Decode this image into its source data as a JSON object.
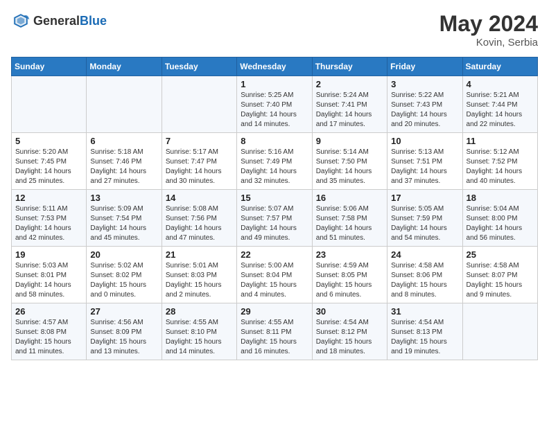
{
  "header": {
    "logo_general": "General",
    "logo_blue": "Blue",
    "month_year": "May 2024",
    "location": "Kovin, Serbia"
  },
  "days_of_week": [
    "Sunday",
    "Monday",
    "Tuesday",
    "Wednesday",
    "Thursday",
    "Friday",
    "Saturday"
  ],
  "weeks": [
    [
      {
        "day": "",
        "info": ""
      },
      {
        "day": "",
        "info": ""
      },
      {
        "day": "",
        "info": ""
      },
      {
        "day": "1",
        "info": "Sunrise: 5:25 AM\nSunset: 7:40 PM\nDaylight: 14 hours\nand 14 minutes."
      },
      {
        "day": "2",
        "info": "Sunrise: 5:24 AM\nSunset: 7:41 PM\nDaylight: 14 hours\nand 17 minutes."
      },
      {
        "day": "3",
        "info": "Sunrise: 5:22 AM\nSunset: 7:43 PM\nDaylight: 14 hours\nand 20 minutes."
      },
      {
        "day": "4",
        "info": "Sunrise: 5:21 AM\nSunset: 7:44 PM\nDaylight: 14 hours\nand 22 minutes."
      }
    ],
    [
      {
        "day": "5",
        "info": "Sunrise: 5:20 AM\nSunset: 7:45 PM\nDaylight: 14 hours\nand 25 minutes."
      },
      {
        "day": "6",
        "info": "Sunrise: 5:18 AM\nSunset: 7:46 PM\nDaylight: 14 hours\nand 27 minutes."
      },
      {
        "day": "7",
        "info": "Sunrise: 5:17 AM\nSunset: 7:47 PM\nDaylight: 14 hours\nand 30 minutes."
      },
      {
        "day": "8",
        "info": "Sunrise: 5:16 AM\nSunset: 7:49 PM\nDaylight: 14 hours\nand 32 minutes."
      },
      {
        "day": "9",
        "info": "Sunrise: 5:14 AM\nSunset: 7:50 PM\nDaylight: 14 hours\nand 35 minutes."
      },
      {
        "day": "10",
        "info": "Sunrise: 5:13 AM\nSunset: 7:51 PM\nDaylight: 14 hours\nand 37 minutes."
      },
      {
        "day": "11",
        "info": "Sunrise: 5:12 AM\nSunset: 7:52 PM\nDaylight: 14 hours\nand 40 minutes."
      }
    ],
    [
      {
        "day": "12",
        "info": "Sunrise: 5:11 AM\nSunset: 7:53 PM\nDaylight: 14 hours\nand 42 minutes."
      },
      {
        "day": "13",
        "info": "Sunrise: 5:09 AM\nSunset: 7:54 PM\nDaylight: 14 hours\nand 45 minutes."
      },
      {
        "day": "14",
        "info": "Sunrise: 5:08 AM\nSunset: 7:56 PM\nDaylight: 14 hours\nand 47 minutes."
      },
      {
        "day": "15",
        "info": "Sunrise: 5:07 AM\nSunset: 7:57 PM\nDaylight: 14 hours\nand 49 minutes."
      },
      {
        "day": "16",
        "info": "Sunrise: 5:06 AM\nSunset: 7:58 PM\nDaylight: 14 hours\nand 51 minutes."
      },
      {
        "day": "17",
        "info": "Sunrise: 5:05 AM\nSunset: 7:59 PM\nDaylight: 14 hours\nand 54 minutes."
      },
      {
        "day": "18",
        "info": "Sunrise: 5:04 AM\nSunset: 8:00 PM\nDaylight: 14 hours\nand 56 minutes."
      }
    ],
    [
      {
        "day": "19",
        "info": "Sunrise: 5:03 AM\nSunset: 8:01 PM\nDaylight: 14 hours\nand 58 minutes."
      },
      {
        "day": "20",
        "info": "Sunrise: 5:02 AM\nSunset: 8:02 PM\nDaylight: 15 hours\nand 0 minutes."
      },
      {
        "day": "21",
        "info": "Sunrise: 5:01 AM\nSunset: 8:03 PM\nDaylight: 15 hours\nand 2 minutes."
      },
      {
        "day": "22",
        "info": "Sunrise: 5:00 AM\nSunset: 8:04 PM\nDaylight: 15 hours\nand 4 minutes."
      },
      {
        "day": "23",
        "info": "Sunrise: 4:59 AM\nSunset: 8:05 PM\nDaylight: 15 hours\nand 6 minutes."
      },
      {
        "day": "24",
        "info": "Sunrise: 4:58 AM\nSunset: 8:06 PM\nDaylight: 15 hours\nand 8 minutes."
      },
      {
        "day": "25",
        "info": "Sunrise: 4:58 AM\nSunset: 8:07 PM\nDaylight: 15 hours\nand 9 minutes."
      }
    ],
    [
      {
        "day": "26",
        "info": "Sunrise: 4:57 AM\nSunset: 8:08 PM\nDaylight: 15 hours\nand 11 minutes."
      },
      {
        "day": "27",
        "info": "Sunrise: 4:56 AM\nSunset: 8:09 PM\nDaylight: 15 hours\nand 13 minutes."
      },
      {
        "day": "28",
        "info": "Sunrise: 4:55 AM\nSunset: 8:10 PM\nDaylight: 15 hours\nand 14 minutes."
      },
      {
        "day": "29",
        "info": "Sunrise: 4:55 AM\nSunset: 8:11 PM\nDaylight: 15 hours\nand 16 minutes."
      },
      {
        "day": "30",
        "info": "Sunrise: 4:54 AM\nSunset: 8:12 PM\nDaylight: 15 hours\nand 18 minutes."
      },
      {
        "day": "31",
        "info": "Sunrise: 4:54 AM\nSunset: 8:13 PM\nDaylight: 15 hours\nand 19 minutes."
      },
      {
        "day": "",
        "info": ""
      }
    ]
  ]
}
